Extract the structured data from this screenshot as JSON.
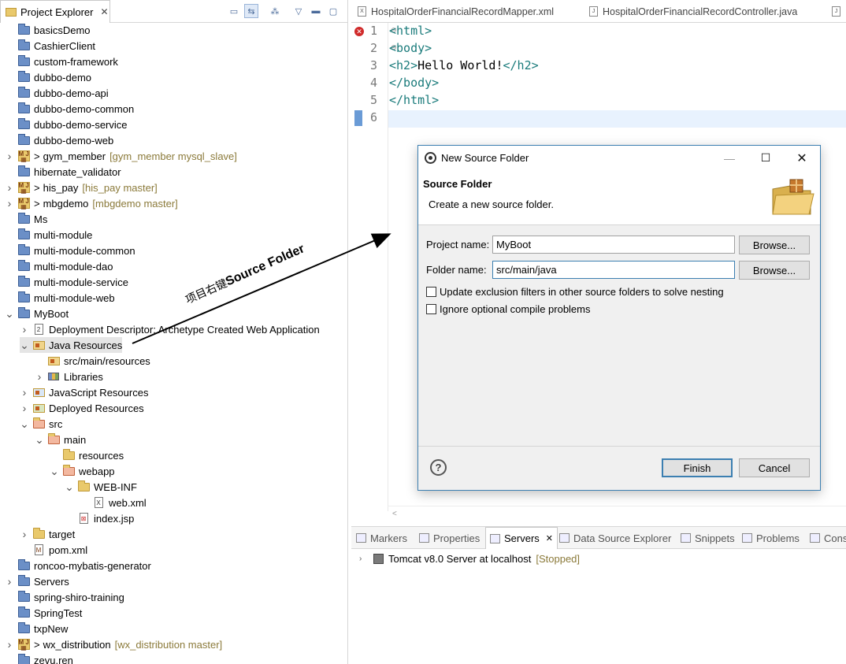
{
  "left_panel": {
    "tab_label": "Project Explorer",
    "tree": [
      {
        "label": "basicsDemo",
        "icon": "project",
        "depth": 0,
        "chevron": ""
      },
      {
        "label": "CashierClient",
        "icon": "project",
        "depth": 0,
        "chevron": ""
      },
      {
        "label": "custom-framework",
        "icon": "project",
        "depth": 0,
        "chevron": ""
      },
      {
        "label": "dubbo-demo",
        "icon": "project",
        "depth": 0,
        "chevron": ""
      },
      {
        "label": "dubbo-demo-api",
        "icon": "project",
        "depth": 0,
        "chevron": ""
      },
      {
        "label": "dubbo-demo-common",
        "icon": "project",
        "depth": 0,
        "chevron": ""
      },
      {
        "label": "dubbo-demo-service",
        "icon": "project",
        "depth": 0,
        "chevron": ""
      },
      {
        "label": "dubbo-demo-web",
        "icon": "project",
        "depth": 0,
        "chevron": ""
      },
      {
        "label": "gym_member",
        "icon": "maven",
        "depth": 0,
        "chevron": ">",
        "prefix": ">",
        "decoration": "[gym_member mysql_slave]"
      },
      {
        "label": "hibernate_validator",
        "icon": "project",
        "depth": 0,
        "chevron": ""
      },
      {
        "label": "his_pay",
        "icon": "maven",
        "depth": 0,
        "chevron": ">",
        "prefix": ">",
        "decoration": "[his_pay master]"
      },
      {
        "label": "mbgdemo",
        "icon": "maven",
        "depth": 0,
        "chevron": ">",
        "prefix": ">",
        "decoration": "[mbgdemo master]"
      },
      {
        "label": "Ms",
        "icon": "project",
        "depth": 0,
        "chevron": ""
      },
      {
        "label": "multi-module",
        "icon": "project",
        "depth": 0,
        "chevron": ""
      },
      {
        "label": "multi-module-common",
        "icon": "project",
        "depth": 0,
        "chevron": ""
      },
      {
        "label": "multi-module-dao",
        "icon": "project",
        "depth": 0,
        "chevron": ""
      },
      {
        "label": "multi-module-service",
        "icon": "project",
        "depth": 0,
        "chevron": ""
      },
      {
        "label": "multi-module-web",
        "icon": "project",
        "depth": 0,
        "chevron": ""
      },
      {
        "label": "MyBoot",
        "icon": "project",
        "depth": 0,
        "chevron": "v"
      },
      {
        "label": "Deployment Descriptor: Archetype Created Web Application",
        "icon": "descriptor",
        "depth": 1,
        "chevron": ">"
      },
      {
        "label": "Java Resources",
        "icon": "javares",
        "depth": 1,
        "chevron": "v",
        "selected": true
      },
      {
        "label": "src/main/resources",
        "icon": "sfolder",
        "depth": 2,
        "chevron": ""
      },
      {
        "label": "Libraries",
        "icon": "lib",
        "depth": 2,
        "chevron": ">"
      },
      {
        "label": "JavaScript Resources",
        "icon": "jsres",
        "depth": 1,
        "chevron": ">"
      },
      {
        "label": "Deployed Resources",
        "icon": "deployed",
        "depth": 1,
        "chevron": ">"
      },
      {
        "label": "src",
        "icon": "redfolder",
        "depth": 1,
        "chevron": "v"
      },
      {
        "label": "main",
        "icon": "redfolder",
        "depth": 2,
        "chevron": "v"
      },
      {
        "label": "resources",
        "icon": "folder",
        "depth": 3,
        "chevron": ""
      },
      {
        "label": "webapp",
        "icon": "redfolder",
        "depth": 3,
        "chevron": "v"
      },
      {
        "label": "WEB-INF",
        "icon": "folder",
        "depth": 4,
        "chevron": "v"
      },
      {
        "label": "web.xml",
        "icon": "xml",
        "depth": 5,
        "chevron": ""
      },
      {
        "label": "index.jsp",
        "icon": "jsp",
        "depth": 4,
        "chevron": ""
      },
      {
        "label": "target",
        "icon": "folder",
        "depth": 1,
        "chevron": ">"
      },
      {
        "label": "pom.xml",
        "icon": "pom",
        "depth": 1,
        "chevron": ""
      },
      {
        "label": "roncoo-mybatis-generator",
        "icon": "project",
        "depth": 0,
        "chevron": ""
      },
      {
        "label": "Servers",
        "icon": "project",
        "depth": 0,
        "chevron": ">"
      },
      {
        "label": "spring-shiro-training",
        "icon": "project",
        "depth": 0,
        "chevron": ""
      },
      {
        "label": "SpringTest",
        "icon": "project",
        "depth": 0,
        "chevron": ""
      },
      {
        "label": "txpNew",
        "icon": "project",
        "depth": 0,
        "chevron": ""
      },
      {
        "label": "wx_distribution",
        "icon": "maven",
        "depth": 0,
        "chevron": ">",
        "prefix": ">",
        "decoration": "[wx_distribution master]"
      },
      {
        "label": "zevu.ren",
        "icon": "project",
        "depth": 0,
        "chevron": ""
      }
    ]
  },
  "editor": {
    "tabs": [
      {
        "label": "HospitalOrderFinancialRecordMapper.xml",
        "icon": "X"
      },
      {
        "label": "HospitalOrderFinancialRecordController.java",
        "icon": "J"
      },
      {
        "label": "",
        "icon": "J"
      }
    ],
    "lines": [
      {
        "num": "1",
        "text": "<html>"
      },
      {
        "num": "2",
        "text": "<body>"
      },
      {
        "num": "3",
        "text": "<h2>Hello World!</h2>"
      },
      {
        "num": "4",
        "text": "</body>"
      },
      {
        "num": "5",
        "text": "</html>"
      },
      {
        "num": "6",
        "text": ""
      }
    ]
  },
  "bottom_panel": {
    "tabs": [
      {
        "label": "Markers"
      },
      {
        "label": "Properties"
      },
      {
        "label": "Servers",
        "active": true
      },
      {
        "label": "Data Source Explorer"
      },
      {
        "label": "Snippets"
      },
      {
        "label": "Problems"
      },
      {
        "label": "Cons"
      }
    ],
    "server_name": "Tomcat v8.0 Server at localhost",
    "server_state": "[Stopped]"
  },
  "annotation": {
    "cn_text": "项目右键",
    "en_text": "Source Folder"
  },
  "dialog": {
    "title": "New Source Folder",
    "header_title": "Source Folder",
    "header_subtitle": "Create a new source folder.",
    "project_label": "Project name:",
    "project_value": "MyBoot",
    "folder_label": "Folder name:",
    "folder_value": "src/main/java",
    "browse_label": "Browse...",
    "check1": "Update exclusion filters in other source folders to solve nesting",
    "check2": "Ignore optional compile problems",
    "finish_label": "Finish",
    "cancel_label": "Cancel",
    "help_glyph": "?"
  }
}
